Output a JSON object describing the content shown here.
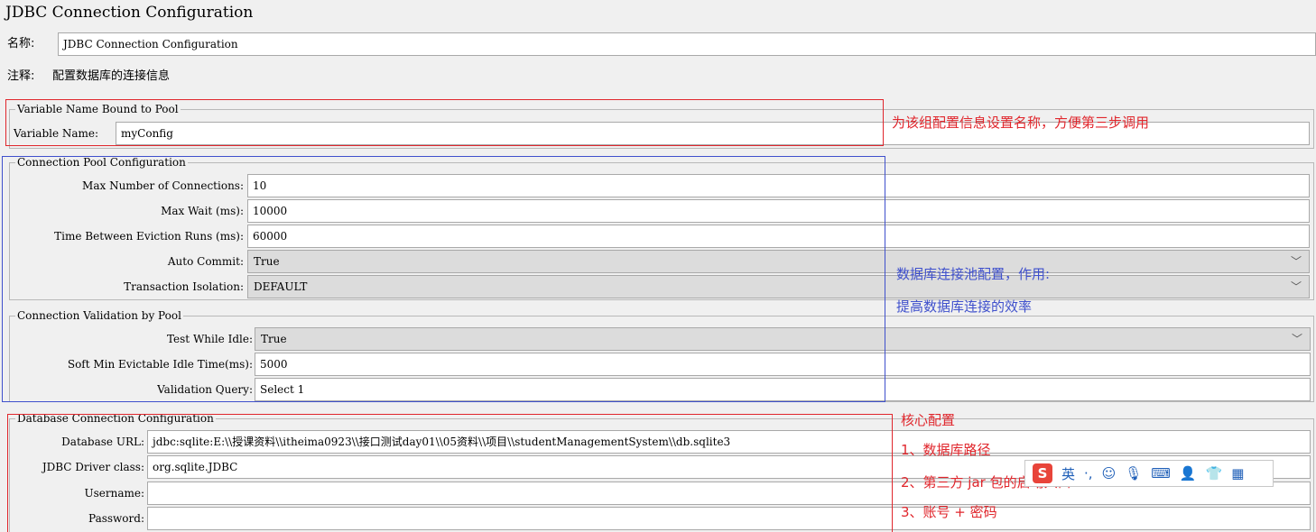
{
  "window": {
    "title": "JDBC Connection Configuration"
  },
  "header": {
    "name_label": "名称:",
    "name_value": "JDBC Connection Configuration",
    "comment_label": "注释:",
    "comment_value": "配置数据库的连接信息"
  },
  "bound_pool": {
    "legend": "Variable Name Bound to Pool",
    "variable_name_label": "Variable Name:",
    "variable_name_value": "myConfig"
  },
  "pool_config": {
    "legend": "Connection Pool Configuration",
    "max_connections_label": "Max Number of Connections:",
    "max_connections_value": "10",
    "max_wait_label": "Max Wait (ms):",
    "max_wait_value": "10000",
    "eviction_label": "Time Between Eviction Runs (ms):",
    "eviction_value": "60000",
    "auto_commit_label": "Auto Commit:",
    "auto_commit_value": "True",
    "isolation_label": "Transaction Isolation:",
    "isolation_value": "DEFAULT"
  },
  "validation": {
    "legend": "Connection Validation by Pool",
    "test_idle_label": "Test While Idle:",
    "test_idle_value": "True",
    "soft_min_label": "Soft Min Evictable Idle Time(ms):",
    "soft_min_value": "5000",
    "query_label": "Validation Query:",
    "query_value": "Select 1"
  },
  "db_config": {
    "legend": "Database Connection Configuration",
    "url_label": "Database URL:",
    "url_value": "jdbc:sqlite:E:\\\\授课资料\\\\itheima0923\\\\接口测试day01\\\\05资料\\\\项目\\\\studentManagementSystem\\\\db.sqlite3",
    "driver_label": "JDBC Driver class:",
    "driver_value": "org.sqlite.JDBC",
    "username_label": "Username:",
    "username_value": "",
    "password_label": "Password:",
    "password_value": ""
  },
  "annotations": {
    "name_note": "为该组配置信息设置名称，方便第三步调用",
    "pool_note_1": "数据库连接池配置，作用:",
    "pool_note_2": "提高数据库连接的效率",
    "core_title": "核心配置",
    "core_1": "1、数据库路径",
    "core_2": "2、第三方 jar 包的启动入口",
    "core_3": "3、账号 + 密码",
    "annotation_red": "#e0262c",
    "annotation_blue": "#3f50cc"
  },
  "ime_toolbar": {
    "logo": "S",
    "lang": "英",
    "dots": "·,",
    "emoji_icon": "☺",
    "mic_icon": "🎙",
    "keyboard_icon": "⌨",
    "user_icon": "👤",
    "shirt_icon": "👕",
    "grid_icon": "▦"
  }
}
